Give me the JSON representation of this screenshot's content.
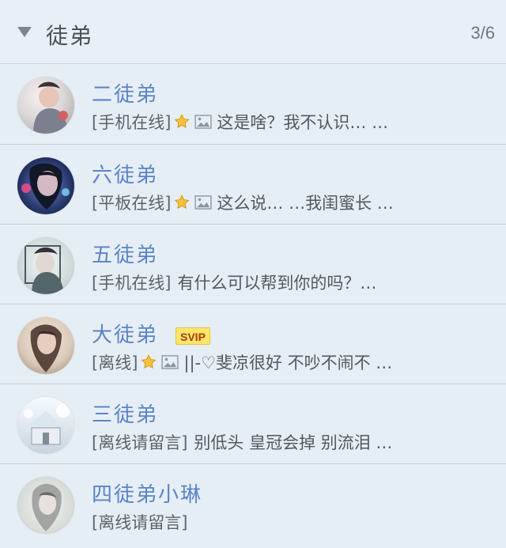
{
  "group": {
    "name": "徒弟",
    "count": "3/6"
  },
  "contacts": [
    {
      "name": "二徒弟",
      "status": "[手机在线]",
      "has_star": true,
      "has_image": true,
      "message": "这是啥？我不认识… …",
      "avatar": "avatar-girl-light"
    },
    {
      "name": "六徒弟",
      "status": "[平板在线]",
      "has_star": true,
      "has_image": true,
      "message": "这么说… …我闺蜜长 …",
      "avatar": "avatar-girl-blue"
    },
    {
      "name": "五徒弟",
      "status": "[手机在线]",
      "has_star": false,
      "has_image": false,
      "message": "有什么可以帮到你的吗？…",
      "avatar": "avatar-girl-pale"
    },
    {
      "name": "大徒弟",
      "badge": "SVIP",
      "status": "[离线]",
      "has_star": true,
      "has_image": true,
      "message": "||-♡斐凉很好 不吵不闹不 …",
      "avatar": "avatar-girl-sepia"
    },
    {
      "name": "三徒弟",
      "status": "[离线请留言]",
      "has_star": false,
      "has_image": false,
      "message": "别低头 皇冠会掉 别流泪 …",
      "avatar": "avatar-house-snow"
    },
    {
      "name": "四徒弟小琳",
      "status": "[离线请留言]",
      "has_star": false,
      "has_image": false,
      "message": "",
      "avatar": "avatar-girl-faded"
    }
  ]
}
